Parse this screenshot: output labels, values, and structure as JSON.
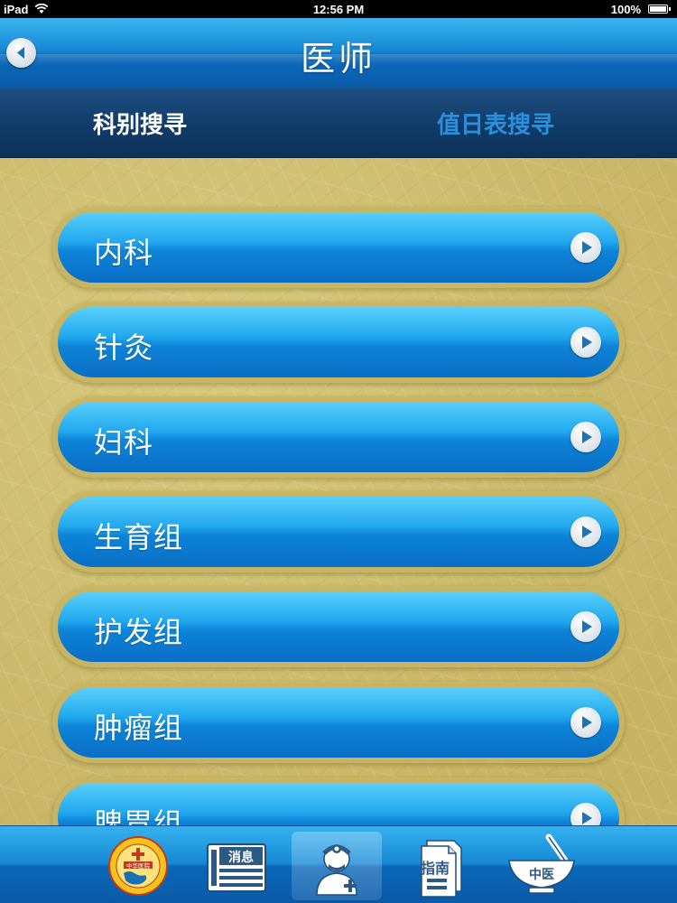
{
  "status_bar": {
    "device": "iPad",
    "time": "12:56 PM",
    "battery": "100%"
  },
  "nav": {
    "title": "医师"
  },
  "segments": {
    "left": "科别搜寻",
    "right": "值日表搜寻"
  },
  "departments": [
    "内科",
    "针灸",
    "妇科",
    "生育组",
    "护发组",
    "肿瘤组",
    "脾胃组"
  ],
  "tabbar": {
    "news_label": "消息",
    "guide_label": "指南",
    "tcm_label": "中医",
    "logo_text": "中华医院"
  },
  "colors": {
    "nav_blue": "#1689d4",
    "segment_navy": "#103a66",
    "active_segment": "#ffffff",
    "inactive_segment": "#2a8fdc",
    "background_tan": "#cfbe70"
  }
}
